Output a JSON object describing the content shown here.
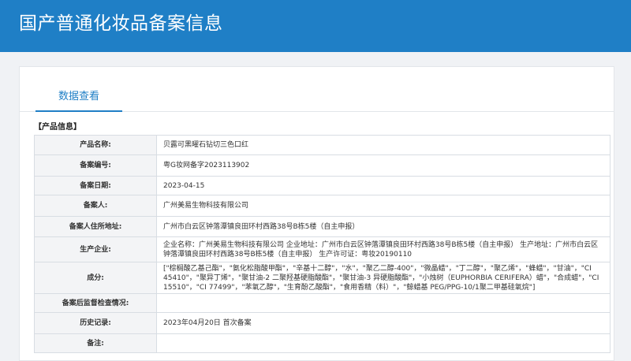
{
  "header": {
    "title": "国产普通化妆品备案信息"
  },
  "tabs": [
    {
      "label": "数据查看"
    }
  ],
  "section": {
    "title": "【产品信息】"
  },
  "rows": [
    {
      "label": "产品名称:",
      "value": "贝露可黑曜石钻切三色口红"
    },
    {
      "label": "备案编号:",
      "value": "粤G妆网备字2023113902"
    },
    {
      "label": "备案日期:",
      "value": "2023-04-15"
    },
    {
      "label": "备案人:",
      "value": "广州美易生物科技有限公司"
    },
    {
      "label": "备案人住所地址:",
      "value": "广州市白云区钟落潭镇良田环村西路38号B栋5楼（自主申报）"
    },
    {
      "label": "生产企业:",
      "value": "企业名称：广州美易生物科技有限公司 企业地址：广州市白云区钟落潭镇良田环村西路38号B栋5楼（自主申报） 生产地址：广州市白云区钟落潭镇良田环村西路38号B栋5楼（自主申报） 生产许可证：粤妆20190110"
    },
    {
      "label": "成分:",
      "value": "[\"棕榈酸乙基己酯\"，\"氨化松脂酸甲酯\"，\"辛基十二醇\"，\"水\"，\"聚乙二醇-400\"，\"微晶蜡\"，\"丁二醇\"，\"聚乙烯\"，\"蜂蜡\"，\"甘油\"，\"CI 45410\"，\"聚异丁烯\"，\"聚甘油-2 二聚羟基硬脂酸酯\"，\"聚甘油-3 异硬脂酸酯\"，\"小烛树（EUPHORBIA CERIFERA）蜡\"，\"合成蜡\"，\"CI 15510\"，\"CI 77499\"，\"苯氧乙醇\"，\"生育酚乙酸酯\"，\"食用香精（料）\"，\"鲸蜡基 PEG/PPG-10/1聚二甲基硅氧烷\"]"
    },
    {
      "label": "备案后监督检查情况:",
      "value": ""
    },
    {
      "label": "历史记录:",
      "value": "2023年04月20日 首次备案"
    },
    {
      "label": "备注:",
      "value": ""
    }
  ]
}
